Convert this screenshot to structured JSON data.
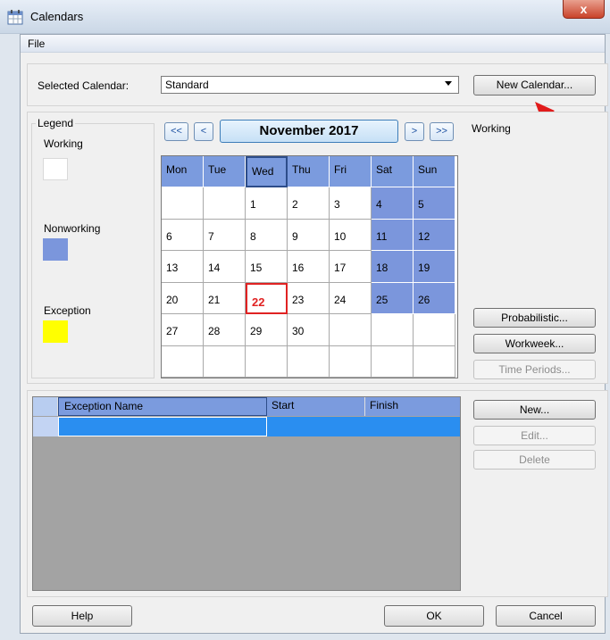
{
  "window": {
    "title": "Calendars",
    "close_glyph": "x"
  },
  "menu": {
    "file": "File"
  },
  "selected_calendar": {
    "label": "Selected Calendar:",
    "value": "Standard",
    "new_calendar_button": "New Calendar..."
  },
  "legend": {
    "title": "Legend",
    "working": "Working",
    "nonworking": "Nonworking",
    "exception": "Exception",
    "colors": {
      "working": "#ffffff",
      "nonworking": "#7b96dc",
      "exception": "#ffff00"
    }
  },
  "calendar": {
    "month": "November 2017",
    "nav": {
      "first": "<<",
      "prev": "<",
      "next": ">",
      "last": ">>"
    },
    "weekdays": [
      "Mon",
      "Tue",
      "Wed",
      "Thu",
      "Fri",
      "Sat",
      "Sun"
    ],
    "weeks": [
      [
        "",
        "",
        "1",
        "2",
        "3",
        "4",
        "5"
      ],
      [
        "6",
        "7",
        "8",
        "9",
        "10",
        "11",
        "12"
      ],
      [
        "13",
        "14",
        "15",
        "16",
        "17",
        "18",
        "19"
      ],
      [
        "20",
        "21",
        "22",
        "23",
        "24",
        "25",
        "26"
      ],
      [
        "27",
        "28",
        "29",
        "30",
        "",
        "",
        ""
      ],
      [
        "",
        "",
        "",
        "",
        "",
        "",
        ""
      ]
    ],
    "today": "22"
  },
  "status": {
    "working": "Working"
  },
  "side_buttons": {
    "probabilistic": "Probabilistic...",
    "workweek": "Workweek...",
    "time_periods": "Time Periods..."
  },
  "exceptions": {
    "columns": [
      "Exception Name",
      "Start",
      "Finish"
    ],
    "new": "New...",
    "edit": "Edit...",
    "delete": "Delete"
  },
  "footer": {
    "help": "Help",
    "ok": "OK",
    "cancel": "Cancel"
  }
}
